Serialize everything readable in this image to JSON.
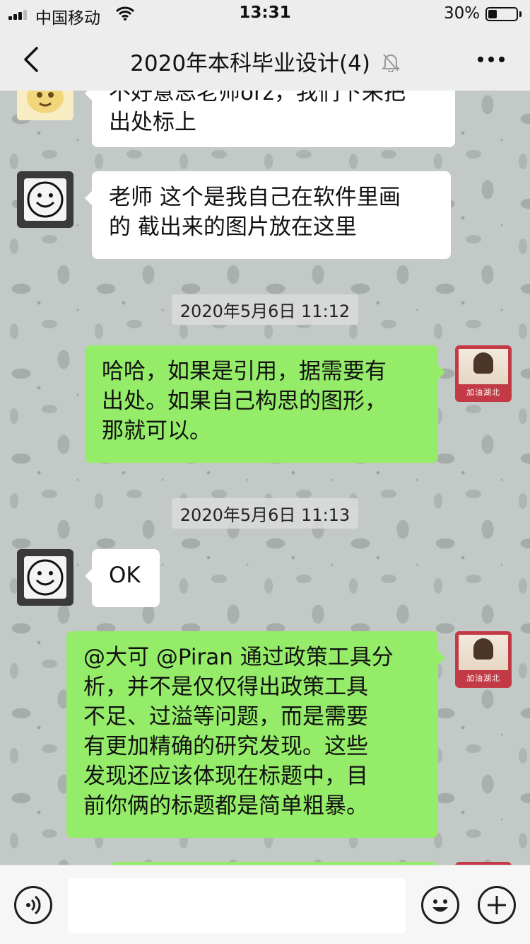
{
  "status_bar": {
    "carrier": "中国移动",
    "time": "13:31",
    "battery": "30%"
  },
  "nav": {
    "title": "2020年本科毕业设计(4)"
  },
  "messages": [
    {
      "side": "left",
      "avatar": "cartoon-avatar",
      "text": "不好意思老师orz，我们下来把出处标上"
    },
    {
      "side": "left",
      "avatar": "smiley-avatar",
      "text": "老师 这个是我自己在软件里画的 截出来的图片放在这里"
    },
    {
      "type": "time",
      "text": "2020年5月6日 11:12"
    },
    {
      "side": "right",
      "avatar": "girl-avatar",
      "text": "哈哈，如果是引用，据需要有出处。如果自己构思的图形，那就可以。"
    },
    {
      "type": "time",
      "text": "2020年5月6日 11:13"
    },
    {
      "side": "left",
      "avatar": "smiley-avatar",
      "text": "OK"
    },
    {
      "side": "right",
      "avatar": "girl-avatar",
      "text": "@大可 @Piran  通过政策工具分析，并不是仅仅得出政策工具不足、过溢等问题，而是需要有更加精确的研究发现。这些发现还应该体现在标题中，目前你俩的标题都是简单粗暴。"
    }
  ],
  "m1_lines": [
    "不好意思老师orz，我们下来把",
    "出处标上"
  ],
  "m2_lines": [
    "老师 这个是我自己在软件里画",
    "的 截出来的图片放在这里"
  ],
  "m3_lines": [
    "哈哈，如果是引用，据需要有",
    "出处。如果自己构思的图形，",
    "那就可以。"
  ],
  "m5_lines": [
    "@大可 @Piran  通过政策工具分",
    "析，并不是仅仅得出政策工具",
    "不足、过溢等问题，而是需要",
    "有更加精确的研究发现。这些",
    "发现还应该体现在标题中，目",
    "前你俩的标题都是简单粗暴。"
  ],
  "avatar_caption": "加油湖北",
  "input": {
    "value": "",
    "placeholder": ""
  },
  "colors": {
    "sent_bubble": "#95ec69",
    "received_bubble": "#ffffff",
    "bar_bg": "#ededed"
  },
  "icons": [
    "back-icon",
    "mute-bell-icon",
    "more-icon",
    "voice-icon",
    "emoji-icon",
    "plus-icon"
  ]
}
